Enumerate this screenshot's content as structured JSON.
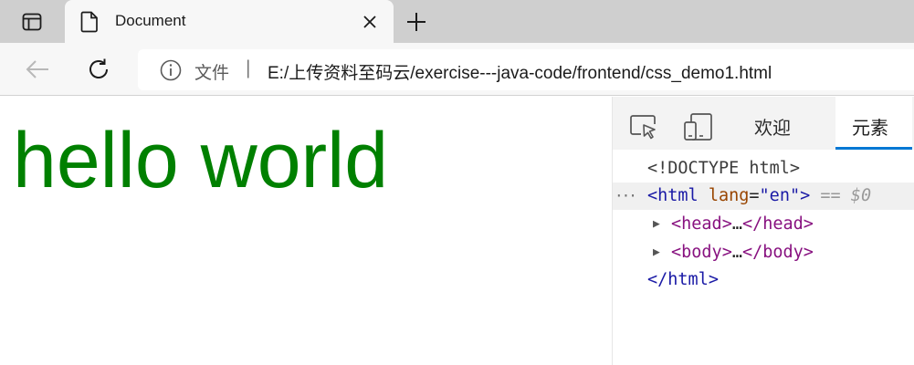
{
  "browser": {
    "tab": {
      "title": "Document",
      "close_icon": "close-icon",
      "doc_icon": "document-icon"
    },
    "toolbar": {
      "address": {
        "scheme_label": "文件",
        "separator": "|",
        "url": "E:/上传资料至码云/exercise---java-code/frontend/css_demo1.html"
      }
    }
  },
  "page": {
    "heading": "hello world",
    "heading_color": "#008000"
  },
  "devtools": {
    "tabs": {
      "welcome": "欢迎",
      "elements": "元素"
    },
    "accent_color": "#0078d4",
    "tree": {
      "doctype": "<!DOCTYPE html>",
      "html_open_tag": "<html",
      "html_attr_name": "lang",
      "html_attr_eq": "=",
      "html_attr_value": "\"en\"",
      "html_open_close": ">",
      "selected_marker": "== $0",
      "head_open": "<head>",
      "ellipsis": "…",
      "head_close": "</head>",
      "body_open": "<body>",
      "body_close": "</body>",
      "html_close": "</html>",
      "row_dots": "···"
    }
  }
}
